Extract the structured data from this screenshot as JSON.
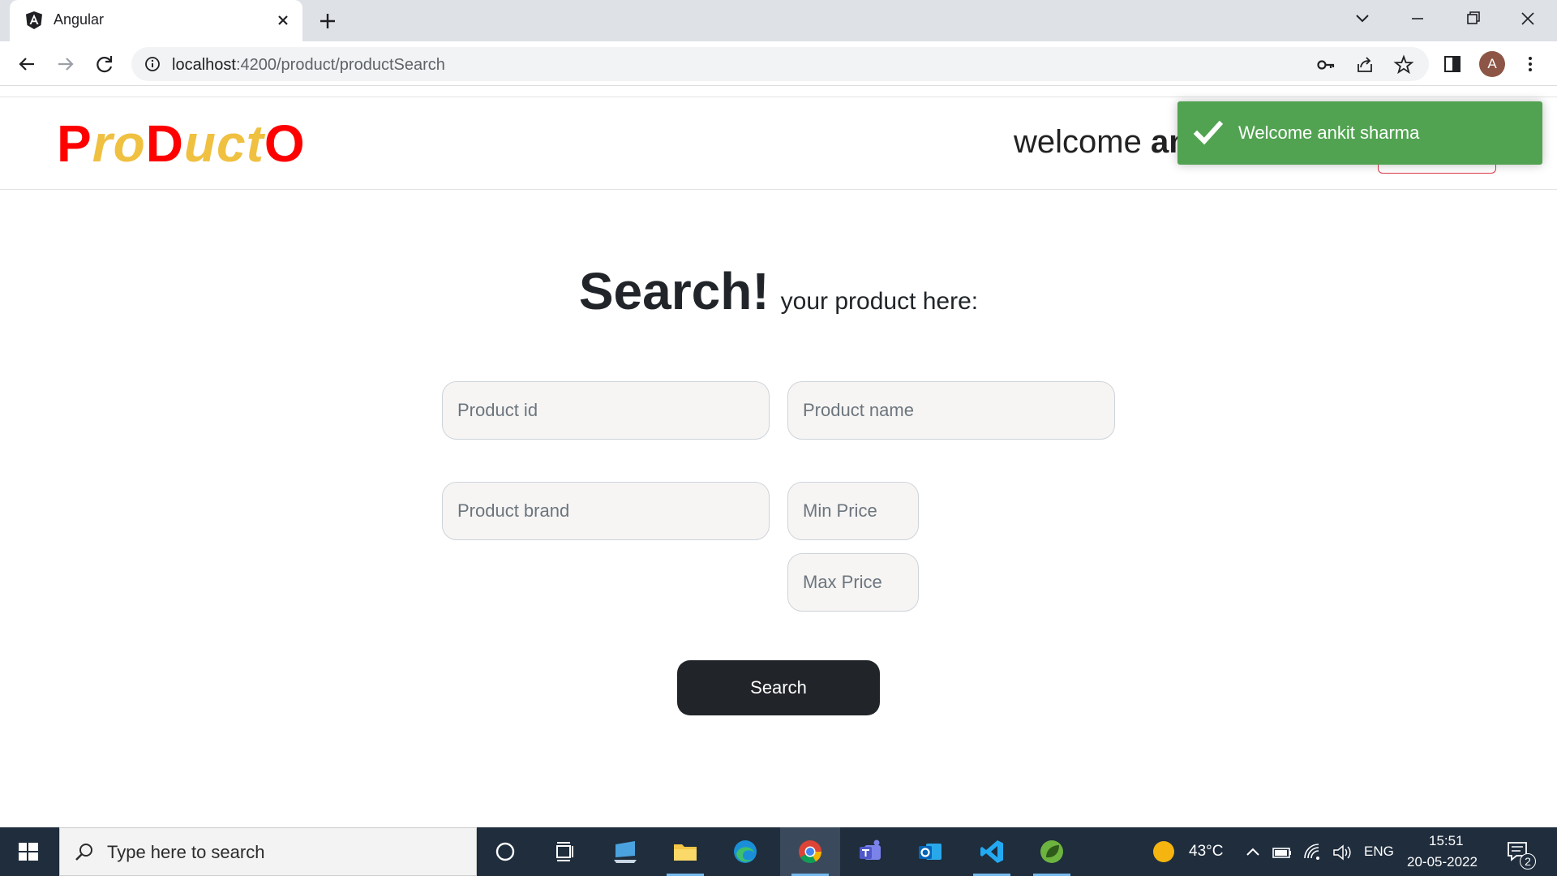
{
  "browser": {
    "tab_title": "Angular",
    "url_host": "localhost",
    "url_path": ":4200/product/productSearch",
    "profile_initial": "A"
  },
  "app": {
    "brand_letters": [
      {
        "text": "P",
        "style": "r"
      },
      {
        "text": "ro",
        "style": "y"
      },
      {
        "text": "D",
        "style": "r"
      },
      {
        "text": "uct",
        "style": "y"
      },
      {
        "text": "O",
        "style": "r"
      }
    ],
    "welcome_prefix": "welcome",
    "welcome_user_visible": "an"
  },
  "toast": {
    "message": "Welcome ankit sharma",
    "color": "#51a351"
  },
  "search": {
    "heading_big": "Search!",
    "heading_small": "your product here:",
    "product_id_placeholder": "Product id",
    "product_name_placeholder": "Product name",
    "product_brand_placeholder": "Product brand",
    "min_price_placeholder": "Min Price",
    "max_price_placeholder": "Max Price",
    "button_label": "Search"
  },
  "taskbar": {
    "search_placeholder": "Type here to search",
    "weather_temp": "43°C",
    "language": "ENG",
    "time": "15:51",
    "date": "20-05-2022",
    "notification_count": "2"
  }
}
